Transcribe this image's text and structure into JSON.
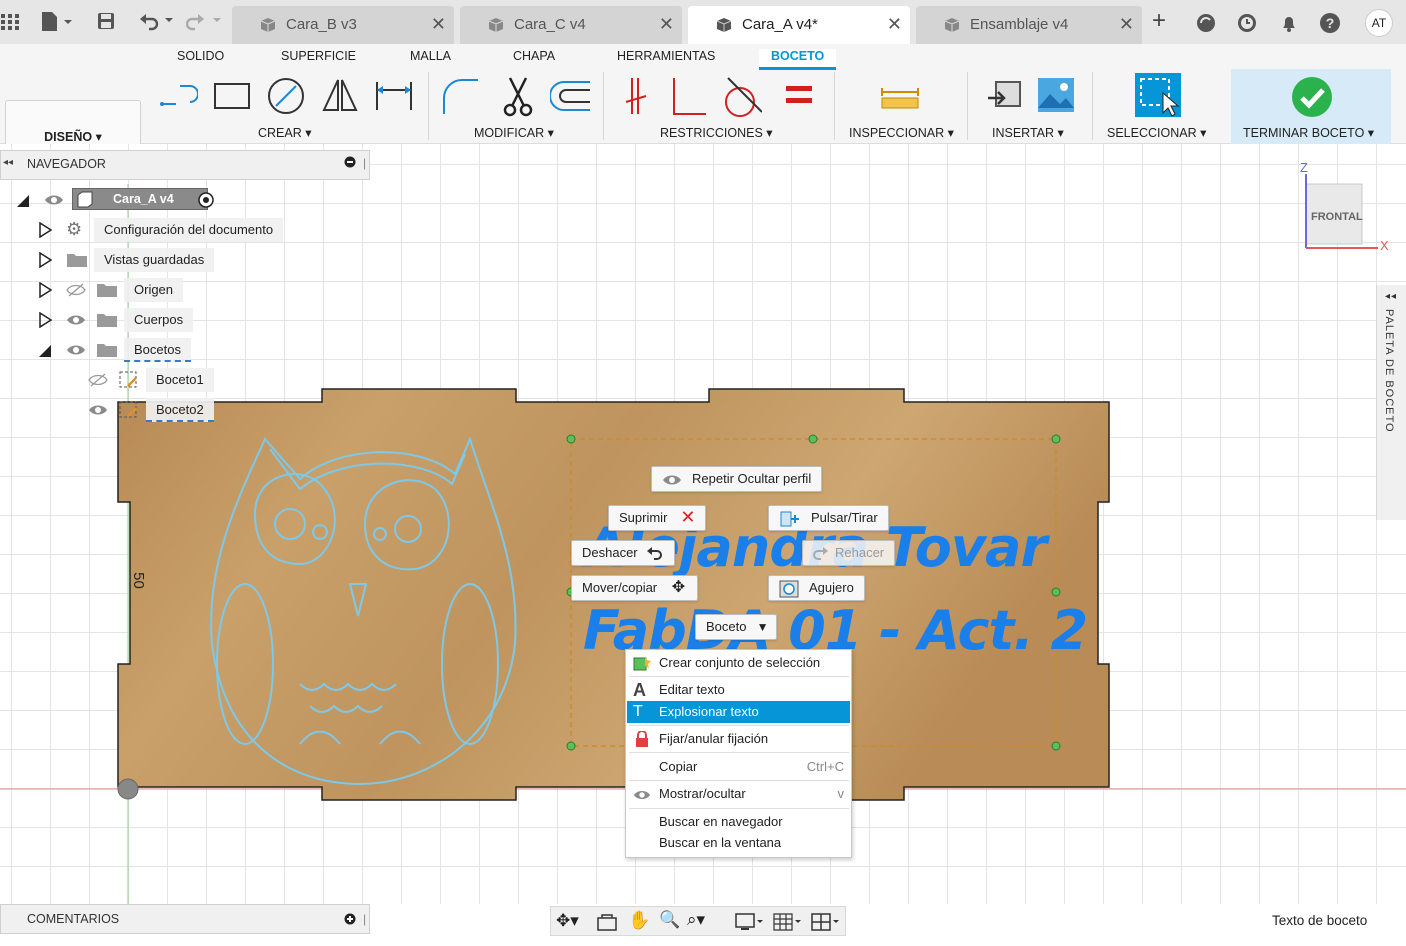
{
  "tabs": [
    {
      "label": "Cara_B v3",
      "active": false
    },
    {
      "label": "Cara_C v4",
      "active": false
    },
    {
      "label": "Cara_A v4*",
      "active": true
    },
    {
      "label": "Ensamblaje v4",
      "active": false
    }
  ],
  "user_initials": "AT",
  "ribbon": {
    "tabs": [
      "SOLIDO",
      "SUPERFICIE",
      "MALLA",
      "CHAPA",
      "HERRAMIENTAS",
      "BOCETO"
    ],
    "active_tab": "BOCETO",
    "workspace": "DISEÑO",
    "groups": {
      "create": "CREAR",
      "modify": "MODIFICAR",
      "constraints": "RESTRICCIONES",
      "inspect": "INSPECCIONAR",
      "insert": "INSERTAR",
      "select": "SELECCIONAR",
      "finish": "TERMINAR BOCETO"
    }
  },
  "navigator": {
    "title": "NAVEGADOR",
    "root": "Cara_A v4",
    "items": [
      {
        "label": "Configuración del documento",
        "icon": "gear-icon"
      },
      {
        "label": "Vistas guardadas",
        "icon": "folder-icon"
      },
      {
        "label": "Origen",
        "icon": "folder-icon",
        "hidden": true
      },
      {
        "label": "Cuerpos",
        "icon": "folder-icon"
      },
      {
        "label": "Bocetos",
        "icon": "folder-icon",
        "expanded": true
      }
    ],
    "sketches": [
      {
        "label": "Boceto1",
        "hidden": true
      },
      {
        "label": "Boceto2",
        "hidden": false
      }
    ]
  },
  "viewcube": {
    "label": "FRONTAL",
    "axis_z": "Z",
    "axis_x": "X"
  },
  "palette": {
    "label": "PALETA DE BOCETO"
  },
  "canvas": {
    "dimension": "50",
    "sketch_text_line1": "Alejandra Tovar",
    "sketch_text_line2": "FabDA 01 - Act. 2"
  },
  "marking_menu": {
    "repeat": "Repetir Ocultar perfil",
    "delete": "Suprimir",
    "press_pull": "Pulsar/Tirar",
    "undo": "Deshacer",
    "redo": "Rehacer",
    "move_copy": "Mover/copiar",
    "hole": "Agujero",
    "sketch": "Boceto"
  },
  "context_menu": [
    {
      "label": "Crear conjunto de selección",
      "icon": "selection-set-icon",
      "shortcut": ""
    },
    {
      "label": "Editar texto",
      "icon": "text-icon",
      "shortcut": ""
    },
    {
      "label": "Explosionar texto",
      "icon": "explode-text-icon",
      "shortcut": "",
      "highlighted": true
    },
    {
      "label": "Fijar/anular fijación",
      "icon": "lock-icon",
      "shortcut": ""
    },
    {
      "label": "Copiar",
      "icon": "",
      "shortcut": "Ctrl+C"
    },
    {
      "label": "Mostrar/ocultar",
      "icon": "eye-icon",
      "shortcut": "v"
    },
    {
      "label": "Buscar en navegador",
      "icon": "",
      "shortcut": ""
    },
    {
      "label": "Buscar en la ventana",
      "icon": "",
      "shortcut": ""
    }
  ],
  "comments": {
    "title": "COMENTARIOS"
  },
  "status": {
    "text": "Texto de boceto"
  },
  "colors": {
    "accent": "#0696d7",
    "wood": "#c49a63",
    "sketch_line": "#7ec8e8",
    "sketch_text": "#1a7fe8",
    "finish_check": "#2cb24c",
    "delete_x": "#e02020"
  }
}
